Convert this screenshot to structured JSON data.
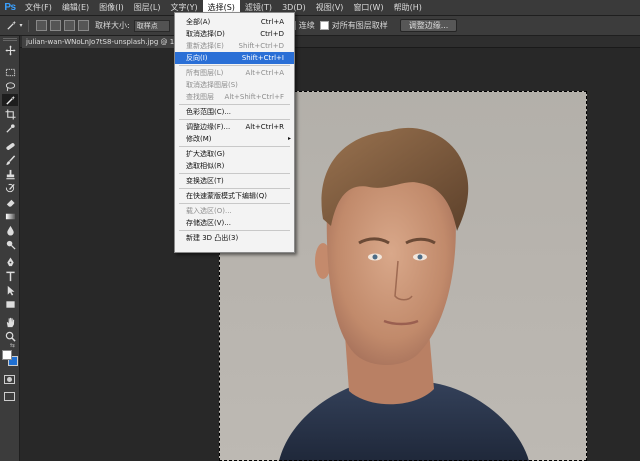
{
  "app": {
    "logo": "Ps"
  },
  "menubar": {
    "items": [
      {
        "label": "文件(F)"
      },
      {
        "label": "编辑(E)"
      },
      {
        "label": "图像(I)"
      },
      {
        "label": "图层(L)"
      },
      {
        "label": "文字(Y)"
      },
      {
        "label": "选择(S)"
      },
      {
        "label": "滤镜(T)"
      },
      {
        "label": "3D(D)"
      },
      {
        "label": "视图(V)"
      },
      {
        "label": "窗口(W)"
      },
      {
        "label": "帮助(H)"
      }
    ],
    "active_index": 5
  },
  "options": {
    "sample_size_label": "取样大小:",
    "sample_size_value": "取样点",
    "contiguous_label": "连续",
    "contiguous_checked": true,
    "sample_all_layers_label": "对所有图层取样",
    "sample_all_layers_checked": false,
    "refine_edge_label": "调整边缘..."
  },
  "document": {
    "tab_title": "julian-wan-WNoLnJo7tS8-unsplash.jpg @ 16.7%(RGB/8)"
  },
  "select_menu": {
    "items": [
      {
        "label": "全部(A)",
        "shortcut": "Ctrl+A",
        "disabled": false
      },
      {
        "label": "取消选择(D)",
        "shortcut": "Ctrl+D",
        "disabled": false
      },
      {
        "label": "重新选择(E)",
        "shortcut": "Shift+Ctrl+D",
        "disabled": true
      },
      {
        "label": "反向(I)",
        "shortcut": "Shift+Ctrl+I",
        "disabled": false,
        "highlighted": true
      },
      {
        "separator": true
      },
      {
        "label": "所有图层(L)",
        "shortcut": "Alt+Ctrl+A",
        "disabled": true
      },
      {
        "label": "取消选择图层(S)",
        "shortcut": "",
        "disabled": true
      },
      {
        "label": "查找图层",
        "shortcut": "Alt+Shift+Ctrl+F",
        "disabled": true
      },
      {
        "separator": true
      },
      {
        "label": "色彩范围(C)...",
        "shortcut": "",
        "disabled": false
      },
      {
        "separator": true
      },
      {
        "label": "调整边缘(F)...",
        "shortcut": "Alt+Ctrl+R",
        "disabled": false
      },
      {
        "label": "修改(M)",
        "shortcut": "",
        "disabled": false,
        "submenu": true
      },
      {
        "separator": true
      },
      {
        "label": "扩大选取(G)",
        "shortcut": "",
        "disabled": false
      },
      {
        "label": "选取相似(R)",
        "shortcut": "",
        "disabled": false
      },
      {
        "separator": true
      },
      {
        "label": "变换选区(T)",
        "shortcut": "",
        "disabled": false
      },
      {
        "separator": true
      },
      {
        "label": "在快速蒙版模式下编辑(Q)",
        "shortcut": "",
        "disabled": false
      },
      {
        "separator": true
      },
      {
        "label": "载入选区(O)...",
        "shortcut": "",
        "disabled": true
      },
      {
        "label": "存储选区(V)...",
        "shortcut": "",
        "disabled": false
      },
      {
        "separator": true
      },
      {
        "label": "新建 3D 凸出(3)",
        "shortcut": "",
        "disabled": false
      }
    ]
  },
  "tools": [
    {
      "icon": "move-tool-icon"
    },
    {
      "icon": "marquee-tool-icon"
    },
    {
      "icon": "lasso-tool-icon"
    },
    {
      "icon": "magic-wand-tool-icon",
      "selected": true
    },
    {
      "icon": "crop-tool-icon"
    },
    {
      "icon": "eyedropper-tool-icon"
    },
    {
      "icon": "spot-healing-tool-icon"
    },
    {
      "icon": "brush-tool-icon"
    },
    {
      "icon": "clone-stamp-tool-icon"
    },
    {
      "icon": "history-brush-tool-icon"
    },
    {
      "icon": "eraser-tool-icon"
    },
    {
      "icon": "gradient-tool-icon"
    },
    {
      "icon": "blur-tool-icon"
    },
    {
      "icon": "dodge-tool-icon"
    },
    {
      "icon": "pen-tool-icon"
    },
    {
      "icon": "type-tool-icon"
    },
    {
      "icon": "path-selection-tool-icon"
    },
    {
      "icon": "rectangle-tool-icon"
    },
    {
      "icon": "hand-tool-icon"
    },
    {
      "icon": "zoom-tool-icon"
    }
  ],
  "colors": {
    "foreground": "#ffffff",
    "background": "#1f6fd1",
    "highlight": "#2a6fd6",
    "app_blue": "#3aa1ff"
  }
}
